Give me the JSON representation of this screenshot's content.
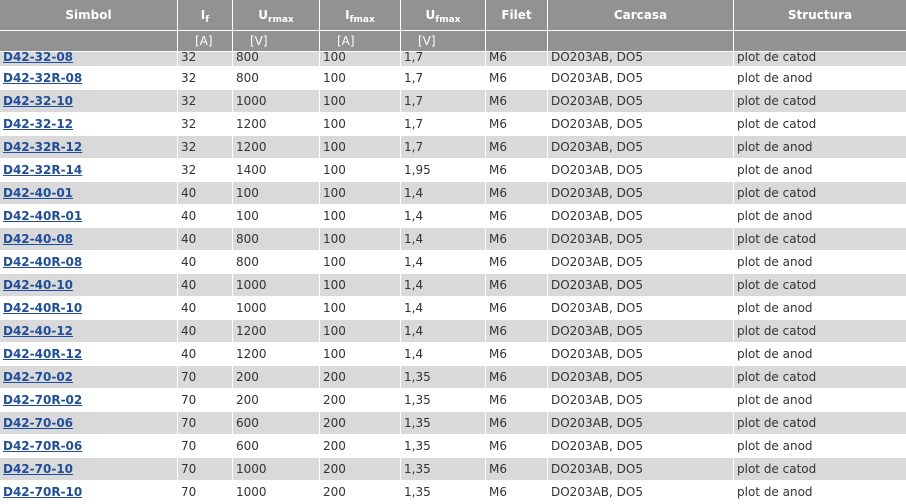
{
  "header": {
    "columns": [
      {
        "key": "simbol",
        "label": "Simbol",
        "sub": ""
      },
      {
        "key": "if",
        "label": "I",
        "sub": "f"
      },
      {
        "key": "urmax",
        "label": "U",
        "sub": "rmax"
      },
      {
        "key": "ifmax",
        "label": "I",
        "sub": "fmax"
      },
      {
        "key": "ufmax",
        "label": "U",
        "sub": "fmax"
      },
      {
        "key": "filet",
        "label": "Filet",
        "sub": ""
      },
      {
        "key": "carcasa",
        "label": "Carcasa",
        "sub": ""
      },
      {
        "key": "structura",
        "label": "Structura",
        "sub": ""
      }
    ],
    "units": [
      "",
      "[A]",
      "[V]",
      "[A]",
      "[V]",
      "",
      "",
      ""
    ]
  },
  "rows": [
    [
      "D42-32-08",
      "32",
      "800",
      "100",
      "1,7",
      "M6",
      "DO203AB, DO5",
      "plot de catod"
    ],
    [
      "D42-32R-08",
      "32",
      "800",
      "100",
      "1,7",
      "M6",
      "DO203AB, DO5",
      "plot de anod"
    ],
    [
      "D42-32-10",
      "32",
      "1000",
      "100",
      "1,7",
      "M6",
      "DO203AB, DO5",
      "plot de catod"
    ],
    [
      "D42-32-12",
      "32",
      "1200",
      "100",
      "1,7",
      "M6",
      "DO203AB, DO5",
      "plot de catod"
    ],
    [
      "D42-32R-12",
      "32",
      "1200",
      "100",
      "1,7",
      "M6",
      "DO203AB, DO5",
      "plot de anod"
    ],
    [
      "D42-32R-14",
      "32",
      "1400",
      "100",
      "1,95",
      "M6",
      "DO203AB, DO5",
      "plot de anod"
    ],
    [
      "D42-40-01",
      "40",
      "100",
      "100",
      "1,4",
      "M6",
      "DO203AB, DO5",
      "plot de catod"
    ],
    [
      "D42-40R-01",
      "40",
      "100",
      "100",
      "1,4",
      "M6",
      "DO203AB, DO5",
      "plot de anod"
    ],
    [
      "D42-40-08",
      "40",
      "800",
      "100",
      "1,4",
      "M6",
      "DO203AB, DO5",
      "plot de catod"
    ],
    [
      "D42-40R-08",
      "40",
      "800",
      "100",
      "1,4",
      "M6",
      "DO203AB, DO5",
      "plot de anod"
    ],
    [
      "D42-40-10",
      "40",
      "1000",
      "100",
      "1,4",
      "M6",
      "DO203AB, DO5",
      "plot de catod"
    ],
    [
      "D42-40R-10",
      "40",
      "1000",
      "100",
      "1,4",
      "M6",
      "DO203AB, DO5",
      "plot de anod"
    ],
    [
      "D42-40-12",
      "40",
      "1200",
      "100",
      "1,4",
      "M6",
      "DO203AB, DO5",
      "plot de catod"
    ],
    [
      "D42-40R-12",
      "40",
      "1200",
      "100",
      "1,4",
      "M6",
      "DO203AB, DO5",
      "plot de anod"
    ],
    [
      "D42-70-02",
      "70",
      "200",
      "200",
      "1,35",
      "M6",
      "DO203AB, DO5",
      "plot de catod"
    ],
    [
      "D42-70R-02",
      "70",
      "200",
      "200",
      "1,35",
      "M6",
      "DO203AB, DO5",
      "plot de anod"
    ],
    [
      "D42-70-06",
      "70",
      "600",
      "200",
      "1,35",
      "M6",
      "DO203AB, DO5",
      "plot de catod"
    ],
    [
      "D42-70R-06",
      "70",
      "600",
      "200",
      "1,35",
      "M6",
      "DO203AB, DO5",
      "plot de anod"
    ],
    [
      "D42-70-10",
      "70",
      "1000",
      "200",
      "1,35",
      "M6",
      "DO203AB, DO5",
      "plot de catod"
    ],
    [
      "D42-70R-10",
      "70",
      "1000",
      "200",
      "1,35",
      "M6",
      "DO203AB, DO5",
      "plot de anod"
    ]
  ],
  "colors": {
    "header_bg": "#929292",
    "row_alt_bg": "#d9d9d9",
    "link": "#1f4e9a"
  }
}
